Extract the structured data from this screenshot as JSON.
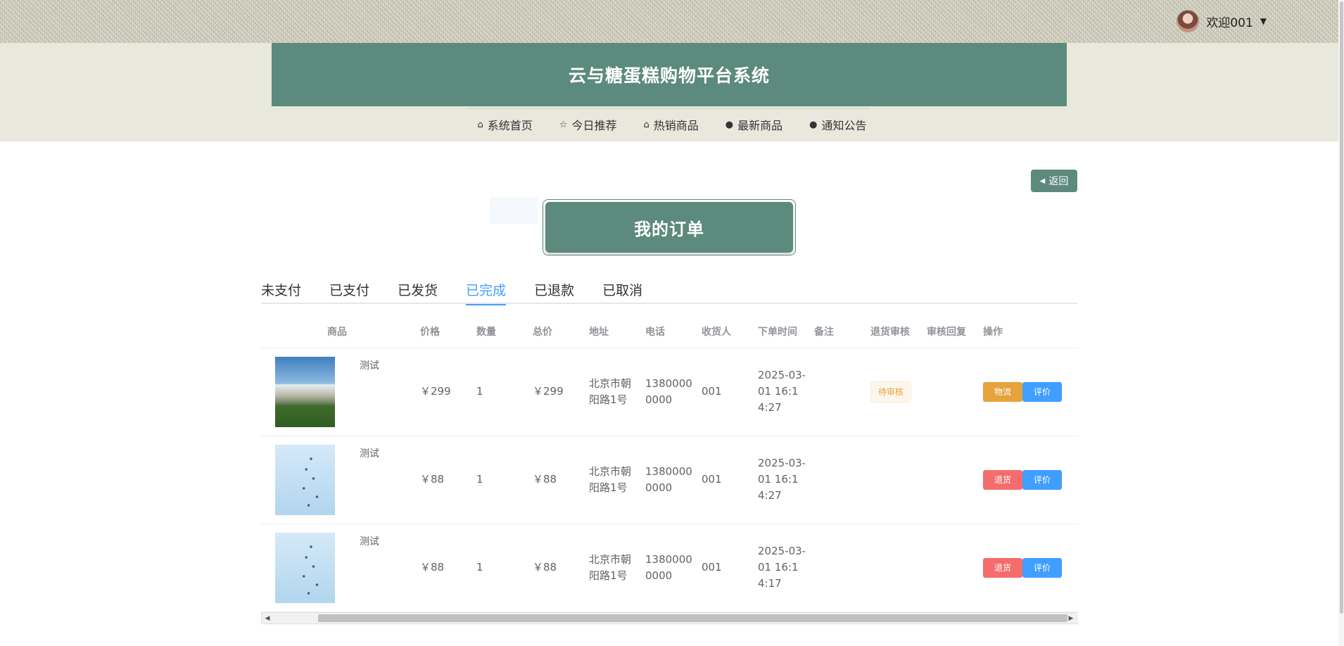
{
  "header": {
    "welcome": "欢迎001",
    "caret": "▼",
    "site_title": "云与糖蛋糕购物平台系统"
  },
  "nav": [
    {
      "icon": "⌂",
      "label": "系统首页"
    },
    {
      "icon": "☆",
      "label": "今日推荐"
    },
    {
      "icon": "⌂",
      "label": "热销商品"
    },
    {
      "icon": "●",
      "label": "最新商品"
    },
    {
      "icon": "●",
      "label": "通知公告"
    }
  ],
  "back_button": {
    "icon": "◀",
    "label": "返回"
  },
  "section_title": "我的订单",
  "tabs": [
    "未支付",
    "已支付",
    "已发货",
    "已完成",
    "已退款",
    "已取消"
  ],
  "active_tab": "已完成",
  "table": {
    "columns": [
      "商品",
      "价格",
      "数量",
      "总价",
      "地址",
      "电话",
      "收货人",
      "下单时间",
      "备注",
      "退货审核",
      "审核回复",
      "操作"
    ],
    "rows": [
      {
        "name": "测试",
        "image": "building",
        "price": "￥299",
        "qty": "1",
        "total": "￥299",
        "address": "北京市朝阳路1号",
        "phone": "13800000000",
        "receiver": "001",
        "time": "2025-03-01 16:14:27",
        "note": "",
        "audit": "待审核",
        "reply": "",
        "actions": [
          "物流",
          "评价"
        ]
      },
      {
        "name": "测试",
        "image": "birds",
        "price": "￥88",
        "qty": "1",
        "total": "￥88",
        "address": "北京市朝阳路1号",
        "phone": "13800000000",
        "receiver": "001",
        "time": "2025-03-01 16:14:27",
        "note": "",
        "audit": "",
        "reply": "",
        "actions": [
          "退货",
          "评价"
        ]
      },
      {
        "name": "测试",
        "image": "birds",
        "price": "￥88",
        "qty": "1",
        "total": "￥88",
        "address": "北京市朝阳路1号",
        "phone": "13800000000",
        "receiver": "001",
        "time": "2025-03-01 16:14:17",
        "note": "",
        "audit": "",
        "reply": "",
        "actions": [
          "退货",
          "评价"
        ]
      }
    ]
  },
  "colors": {
    "theme": "#5c8a7c",
    "primary": "#409eff",
    "warning": "#e6a23c",
    "danger": "#f56c6c"
  }
}
